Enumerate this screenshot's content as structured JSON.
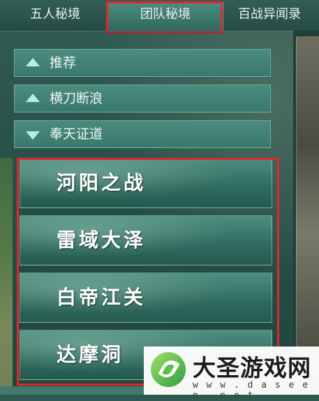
{
  "tabs": [
    {
      "label": "五人秘境",
      "active": false
    },
    {
      "label": "团队秘境",
      "active": true
    },
    {
      "label": "百战异闻录",
      "active": false
    }
  ],
  "categories": [
    {
      "label": "推荐",
      "arrow": "up-triangle-icon"
    },
    {
      "label": "横刀断浪",
      "arrow": "up-triangle-icon"
    },
    {
      "label": "奉天证道",
      "arrow": "down-triangle-icon"
    }
  ],
  "dungeons": [
    {
      "name": "河阳之战"
    },
    {
      "name": "雷域大泽"
    },
    {
      "name": "白帝江关"
    },
    {
      "name": "达摩洞"
    }
  ],
  "watermark": {
    "title": "大圣游戏网",
    "url": "w w w . d a s e e n . n e t"
  },
  "colors": {
    "highlight_box": "#e3262b",
    "panel_teal": "#3a786d",
    "active_tab": "#4d8d7f"
  }
}
